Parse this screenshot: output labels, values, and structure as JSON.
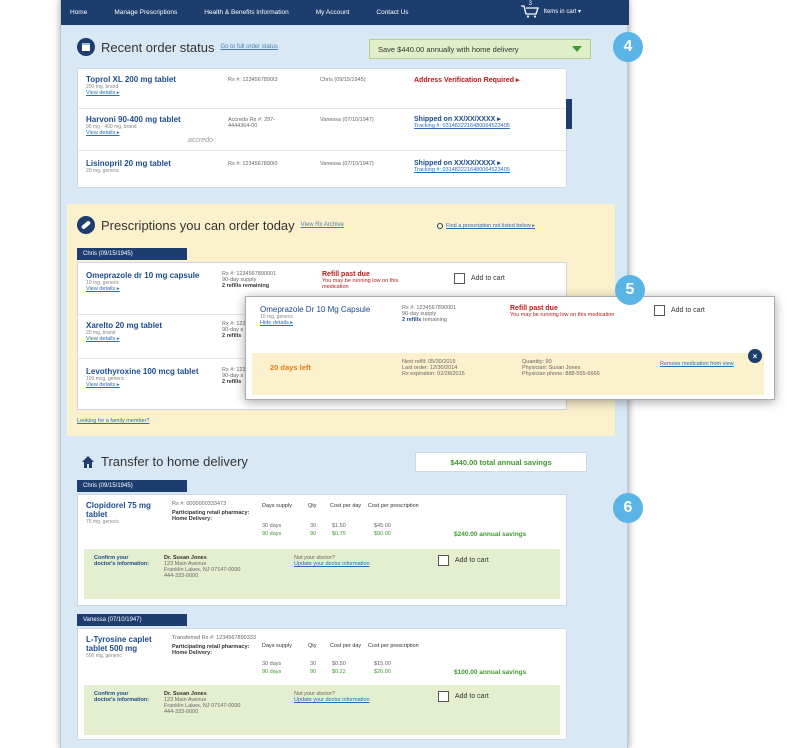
{
  "nav": {
    "items": [
      "Home",
      "Manage Prescriptions",
      "Health & Benefits Information",
      "My Account",
      "Contact Us"
    ],
    "cart_count": "3",
    "cart_label": "Items in cart ▾"
  },
  "callouts": [
    "4",
    "5",
    "6"
  ],
  "recent": {
    "title": "Recent order status",
    "link": "Go to full order status",
    "promo": "Save $440.00 annually with home delivery",
    "orders": [
      {
        "name": "Toprol XL 200 mg tablet",
        "sub": "200 mg, brand",
        "link": "View details ▸",
        "rx": "Rx #: 1234567890I3",
        "patient": "Chris (09/15/1945)",
        "status": "Address Verification Required ▸",
        "status_type": "red",
        "tracking": ""
      },
      {
        "name": "Harvoni 90-400 mg tablet",
        "sub": "90 mg - 400 mg, brand",
        "link": "View details ▸",
        "rx": "Accredo Rx #: 297-4444364-00",
        "patient": "Vanessa (07/10/1947)",
        "status": "Shipped on XX/XX/XXXX ▸",
        "status_type": "blue",
        "tracking": "Tracking #: 0314822216480064523405",
        "accredo": "accredo"
      },
      {
        "name": "Lisinopril 20 mg tablet",
        "sub": "20 mg, generic",
        "link": "",
        "rx": "Rx #: 1234567890I0",
        "patient": "Vanessa (07/10/1947)",
        "status": "Shipped on XX/XX/XXXX ▸",
        "status_type": "blue",
        "tracking": "Tracking #: 0314822216480064523405"
      }
    ]
  },
  "today": {
    "title": "Prescriptions you can order today",
    "link": "View Rx Archive",
    "find": "Find a prescription not listed below ▸",
    "patient_tab": "Chris (09/15/1945)",
    "items": [
      {
        "name": "Omeprazole dr 10 mg capsule",
        "sub": "10 mg, generic",
        "link": "View details ▸",
        "rx": "Rx #: 1234567890001",
        "supply": "90-day supply",
        "refills": "2 refills remaining",
        "status": "Refill past due",
        "status_sub": "You may be running low on this medication",
        "add": "Add to cart"
      },
      {
        "name": "Xarelto 20 mg tablet",
        "sub": "20 mg, brand",
        "link": "View details ▸",
        "rx": "Rx #: 1234",
        "supply": "90-day s",
        "refills": "2 refills"
      },
      {
        "name": "Levothyroxine 100 mcg tablet",
        "sub": "100 mcg, generic",
        "link": "View details ▸",
        "rx": "Rx #: 1234",
        "supply": "90-day s",
        "refills": "2 refills"
      }
    ],
    "family": "Looking for a family member?"
  },
  "popup": {
    "name": "Omeprazole Dr 10 Mg Capsule",
    "sub": "10 mg, generic",
    "link": "Hide details ▸",
    "rx": "Rx #: 1234567890001",
    "supply": "90-day supply",
    "refills": "2 refills",
    "remaining": "remaining",
    "status": "Refill past due",
    "status_sub": "You may be running low on this medication",
    "add": "Add to cart",
    "days_left": "20 days left",
    "next_refill": "Next refill: 05/30/2015",
    "last_order": "Last order: 12/30/2014",
    "expiration": "Rx expiration: 02/28/2015",
    "quantity": "Quantity: 90",
    "physician": "Physician: Susan Jones",
    "phone": "Physician phone: 888-555-6666",
    "remove": "Remove medication from view"
  },
  "transfer": {
    "title": "Transfer to home delivery",
    "savings": "$440.00 total annual savings",
    "cols": [
      "Days supply",
      "Qty",
      "Cost per day",
      "Cost per prescription"
    ],
    "blocks": [
      {
        "tab": "Chris (09/15/1945)",
        "name": "Clopidorel 75 mg tablet",
        "sub": "75 mg, generic",
        "rx": "Rx #: 0000000333473",
        "p1": "Participating retail pharmacy:",
        "p2": "Home Delivery:",
        "r1": [
          "30 days",
          "30",
          "$1.50",
          "$45.00"
        ],
        "r2": [
          "90 days",
          "90",
          "$0.75",
          "$90.00"
        ],
        "save": "$240.00 annual savings",
        "confirm": "Confirm your doctor's information:",
        "doctor": "Dr. Susan Jones",
        "addr1": "123 Main Avenue",
        "addr2": "Franklin Lakes, NJ 07147-0000",
        "dphone": "444-333-0000",
        "notdoc": "Not your doctor?",
        "update": "Update your doctor information",
        "add": "Add to cart"
      },
      {
        "tab": "Vanessa (07/10/1947)",
        "name": "L-Tyrosine caplet tablet 500 mg",
        "sub": "500 mg, generic",
        "rx": "Transferred Rx #: 1234567890333",
        "p1": "Participating retail pharmacy:",
        "p2": "Home Delivery:",
        "r1": [
          "30 days",
          "30",
          "$0.50",
          "$15.00"
        ],
        "r2": [
          "90 days",
          "90",
          "$0.22",
          "$20.00"
        ],
        "save": "$100.00 annual savings",
        "confirm": "Confirm your doctor's information:",
        "doctor": "Dr. Susan Jones",
        "addr1": "123 Main Avenue",
        "addr2": "Franklin Lakes, NJ 07147-0000",
        "dphone": "444-333-0000",
        "notdoc": "Not your doctor?",
        "update": "Update your doctor information",
        "add": "Add to cart"
      }
    ]
  },
  "colors": {
    "nav": "#1c3d6e",
    "red": "#b61a1a",
    "green": "#3e9b2e",
    "callout": "#5ab4e6",
    "yellow": "#fbf1cc",
    "orange": "#e87a13"
  }
}
